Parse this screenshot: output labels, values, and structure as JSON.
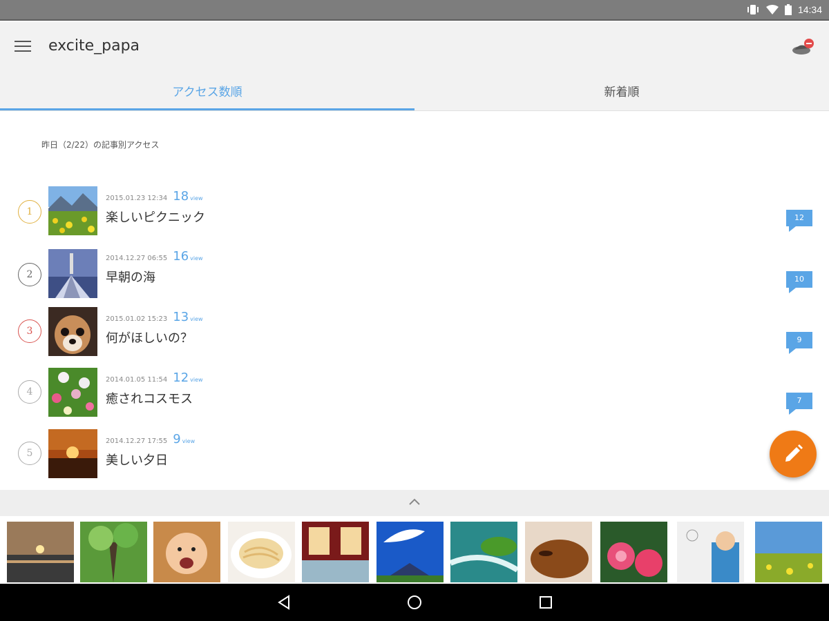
{
  "status_bar": {
    "time": "14:34",
    "icons": [
      "vibrate-icon",
      "wifi-icon",
      "battery-icon"
    ]
  },
  "app_bar": {
    "title": "excite_papa",
    "menu_icon": "menu-icon",
    "notification_icon": "notification-icon"
  },
  "tabs": [
    {
      "label": "アクセス数順",
      "active": true
    },
    {
      "label": "新着順",
      "active": false
    }
  ],
  "section_label": "昨日（2/22）の記事別アクセス",
  "posts": [
    {
      "rank": "1",
      "date": "2015.01.23 12:34",
      "views": "18",
      "view_unit": "view",
      "title": "楽しいピクニック",
      "comments": "12",
      "rank_color": "#e0b040"
    },
    {
      "rank": "2",
      "date": "2014.12.27 06:55",
      "views": "16",
      "view_unit": "view",
      "title": "早朝の海",
      "comments": "10",
      "rank_color": "#666666"
    },
    {
      "rank": "3",
      "date": "2015.01.02 15:23",
      "views": "13",
      "view_unit": "view",
      "title": "何がほしいの？",
      "comments": "9",
      "rank_color": "#d9534f"
    },
    {
      "rank": "4",
      "date": "2014.01.05 11:54",
      "views": "12",
      "view_unit": "view",
      "title": "癒されコスモス",
      "comments": "7",
      "rank_color": "#aaaaaa"
    },
    {
      "rank": "5",
      "date": "2014.12.27 17:55",
      "views": "9",
      "view_unit": "view",
      "title": "美しい夕日",
      "comments": "",
      "rank_color": "#aaaaaa"
    }
  ],
  "colors": {
    "accent": "#5aa5e6",
    "fab": "#ef7a16",
    "comment_bubble": "#5aa5e6"
  },
  "fab_icon": "pencil-icon",
  "drawer_handle_icon": "chevron-up-icon",
  "photo_strip": [
    "sunset-sea",
    "green-trees",
    "laughing-baby",
    "pasta",
    "japanese-room",
    "blue-sky-mountain",
    "stream-moss",
    "sleeping-dog",
    "pink-lotus",
    "child-drawing",
    "flower-field"
  ],
  "nav_bar": [
    "back-icon",
    "home-icon",
    "recents-icon"
  ]
}
